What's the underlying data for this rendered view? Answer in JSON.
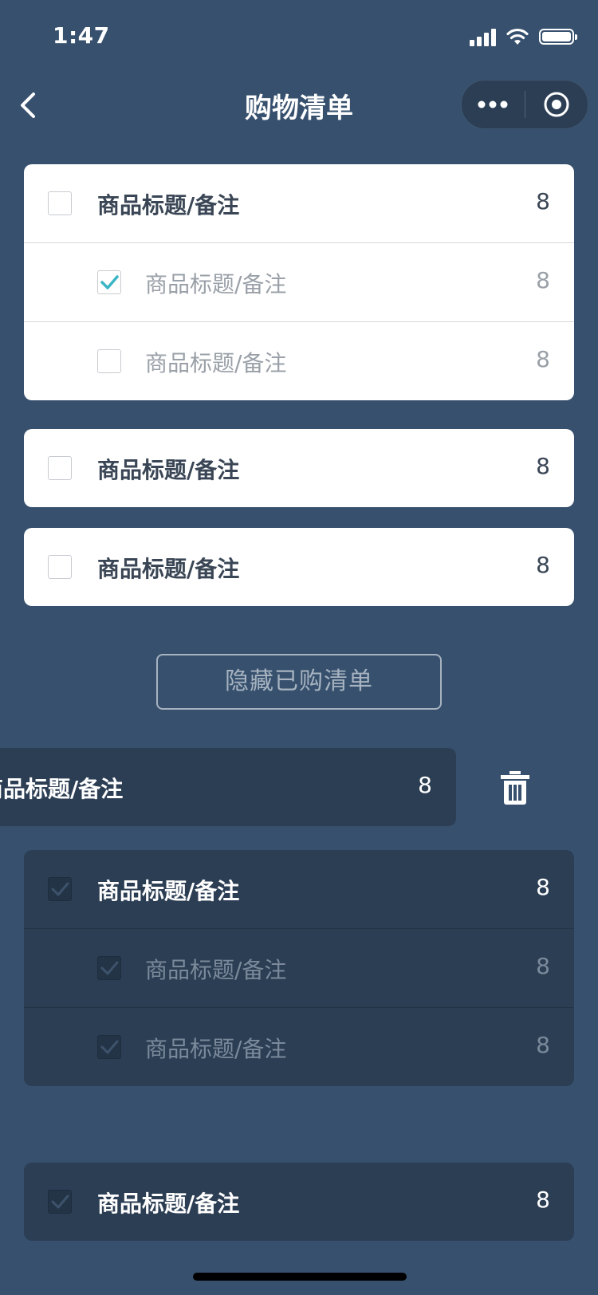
{
  "status_bar": {
    "time": "1:47"
  },
  "nav": {
    "title": "购物清单"
  },
  "groups": [
    {
      "main": {
        "label": "商品标题/备注",
        "count": "8",
        "checked": false
      },
      "subs": [
        {
          "label": "商品标题/备注",
          "count": "8",
          "checked": true
        },
        {
          "label": "商品标题/备注",
          "count": "8",
          "checked": false
        }
      ]
    },
    {
      "main": {
        "label": "商品标题/备注",
        "count": "8",
        "checked": false
      }
    },
    {
      "main": {
        "label": "商品标题/备注",
        "count": "8",
        "checked": false
      }
    }
  ],
  "hide_purchased_label": "隐藏已购清单",
  "swiped_item": {
    "label": "商品标题/备注",
    "count": "8"
  },
  "purchased_groups": [
    {
      "main": {
        "label": "商品标题/备注",
        "count": "8",
        "checked": true
      },
      "subs": [
        {
          "label": "商品标题/备注",
          "count": "8",
          "checked": true
        },
        {
          "label": "商品标题/备注",
          "count": "8",
          "checked": true
        }
      ]
    },
    {
      "main": {
        "label": "商品标题/备注",
        "count": "8",
        "checked": true
      }
    }
  ],
  "colors": {
    "background": "#36506d",
    "card_active": "#ffffff",
    "card_purchased": "#2c3e54",
    "check_accent": "#3bb5c4"
  }
}
